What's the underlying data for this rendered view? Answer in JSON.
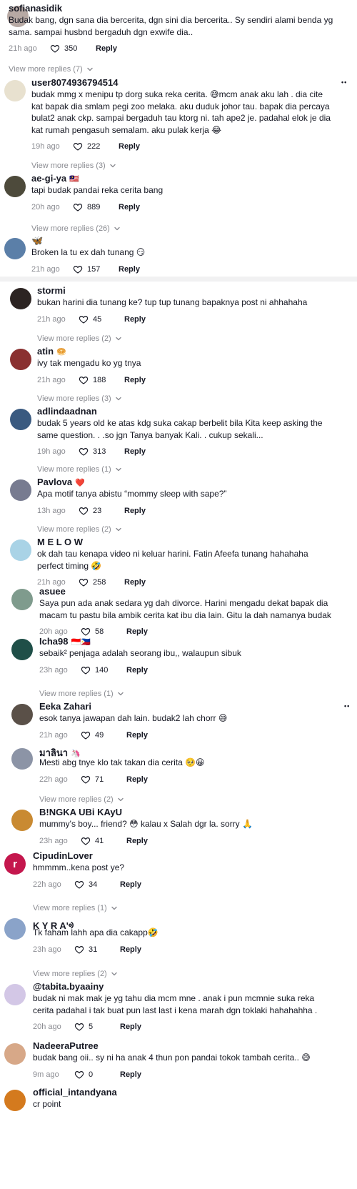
{
  "comments": [
    {
      "username": "sofianasidik",
      "text": "Budak bang, dgn sana dia bercerita, dgn sini dia bercerita.. Sy sendiri alami benda yg sama. sampai husbnd bergaduh dgn exwife dia..",
      "time": "21h ago",
      "likes": "350",
      "view_more": "View more replies (7)",
      "avatar_color": "#b7a9a4"
    },
    {
      "username": "user8074936794514",
      "text": "budak mmg x menipu tp dorg suka reka cerita. 😅mcm anak aku lah . dia cite kat bapak dia smlam pegi zoo melaka. aku duduk johor tau. bapak dia percaya bulat2 anak ckp. sampai bergaduh tau ktorg ni. tah ape2 je. padahal elok je dia kat rumah pengasuh semalam. aku pulak kerja 😂",
      "time": "19h ago",
      "likes": "222",
      "view_more": "View more replies (3)",
      "avatar_color": "#e8e1cf"
    },
    {
      "username": "ae-gi-ya",
      "flag": "🇲🇾",
      "text": "tapi budak pandai reka cerita bang",
      "time": "20h ago",
      "likes": "889",
      "view_more": "View more replies (26)",
      "avatar_color": "#4d4a3b"
    },
    {
      "username": "🦋",
      "text": "Broken la tu ex dah tunang 😏",
      "time": "21h ago",
      "likes": "157",
      "view_more": "",
      "avatar_color": "#5b7fa8"
    },
    {
      "username": "stormi",
      "text": "bukan harini dia tunang ke? tup tup tunang bapaknya post ni ahhahaha",
      "time": "21h ago",
      "likes": "45",
      "view_more": "View more replies (2)",
      "avatar_color": "#2c2422"
    },
    {
      "username": "atin",
      "flag": "🥯",
      "text": "ivy tak mengadu ko yg tnya",
      "time": "21h ago",
      "likes": "188",
      "view_more": "View more replies (3)",
      "avatar_color": "#8a3030"
    },
    {
      "username": "adlindaadnan",
      "text": "budak 5 years old ke atas kdg suka cakap berbelit bila Kita keep asking the same question. . .so jgn Tanya banyak Kali. . cukup sekali...",
      "time": "19h ago",
      "likes": "313",
      "view_more": "View more replies (1)",
      "avatar_color": "#3a5a80"
    },
    {
      "username": "Pavlova",
      "flag": "❤️",
      "text": "Apa motif tanya abistu “mommy sleep with sape?”",
      "time": "13h ago",
      "likes": "23",
      "view_more": "View more replies (2)",
      "avatar_color": "#777b90"
    },
    {
      "username": "M E L O W",
      "text": "ok dah tau kenapa video ni keluar harini. Fatin Afeefa tunang hahahaha perfect timing 🤣",
      "time": "21h ago",
      "likes": "258",
      "view_more": "",
      "avatar_color": "#a9d3e6"
    },
    {
      "username": "asuee",
      "text": "Saya pun ada anak sedara yg dah divorce. Harini mengadu dekat bapak dia macam tu pastu bila ambik cerita kat ibu dia lain. Gitu la dah namanya budak",
      "time": "20h ago",
      "likes": "58",
      "view_more": "",
      "avatar_color": "#7f9b8d"
    },
    {
      "username": "Icha98",
      "flag": "🇮🇩🇵🇭",
      "text": "sebaik² penjaga adalah seorang ibu,, walaupun sibuk",
      "time": "23h ago",
      "likes": "140",
      "view_more": "View more replies (1)",
      "avatar_color": "#1f4f48"
    },
    {
      "username": "Eeka Zahari",
      "text": "esok tanya jawapan dah lain. budak2 lah chorr 😅",
      "time": "21h ago",
      "likes": "49",
      "view_more": "",
      "avatar_color": "#5a5048"
    },
    {
      "username": "มาลินา",
      "flag": "🦄",
      "text": "Mesti abg tnye klo tak takan dia cerita 🥺😀",
      "time": "22h ago",
      "likes": "71",
      "view_more": "View more replies (2)",
      "avatar_color": "#8c94a6"
    },
    {
      "username": "B!NGKA UBi KAyU",
      "text": "mummy's boy... friend? 😳 kalau x Salah dgr la. sorry 🙏",
      "time": "23h ago",
      "likes": "41",
      "view_more": "",
      "avatar_color": "#c98a32"
    },
    {
      "username": "CipudinLover",
      "avatar_letter": "r",
      "text": "hmmmm..kena post ye?",
      "time": "22h ago",
      "likes": "34",
      "view_more": "View more replies (1)",
      "avatar_color": "#c4174d"
    },
    {
      "username": "K Y R A'ᢀ",
      "text": "Tk faham lahh apa dia cakapp🤣",
      "time": "23h ago",
      "likes": "31",
      "view_more": "View more replies (2)",
      "avatar_color": "#8aa3c9"
    },
    {
      "username": "@tabita.byaainy",
      "text": "budak ni mak mak je yg tahu dia mcm mne . anak i pun mcmnie suka reka cerita padahal i tak buat pun last last i kena marah dgn toklaki hahahahha .",
      "time": "20h ago",
      "likes": "5",
      "view_more": "",
      "avatar_color": "#d3c7e6"
    },
    {
      "username": "NadeeraPutree",
      "text": "budak bang oii.. sy ni ha anak 4 thun pon pandai tokok tambah cerita.. 😅",
      "time": "9m ago",
      "likes": "0",
      "view_more": "",
      "avatar_color": "#d7a888"
    },
    {
      "username": "official_intandyana",
      "text": "cr point",
      "time": "",
      "likes": "",
      "view_more": "",
      "avatar_color": "#d47a1e"
    }
  ],
  "labels": {
    "reply": "Reply",
    "more_dots": "••"
  },
  "icons": {
    "like": "heart-outline-icon",
    "chevron": "chevron-down-icon",
    "more": "more-options-icon"
  },
  "colors": {
    "text_primary": "#161823",
    "text_secondary": "#8a8b91",
    "divider": "#f1f1f2"
  }
}
